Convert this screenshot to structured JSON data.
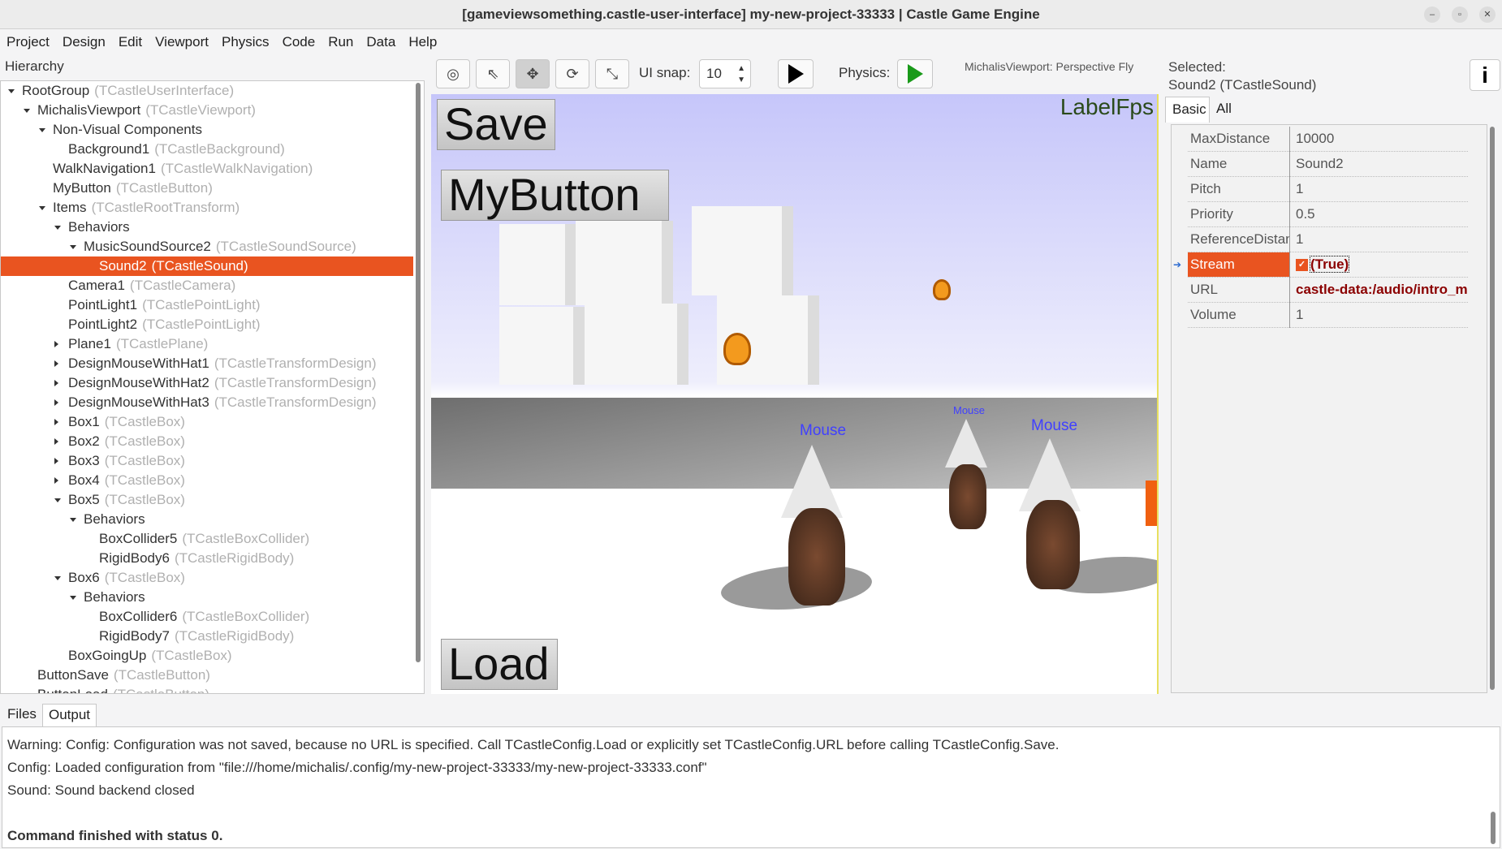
{
  "window": {
    "title": "[gameviewsomething.castle-user-interface] my-new-project-33333 | Castle Game Engine",
    "controls": [
      "–",
      "▫",
      "✕"
    ]
  },
  "menu": [
    "Project",
    "Design",
    "Edit",
    "Viewport",
    "Physics",
    "Code",
    "Run",
    "Data",
    "Help"
  ],
  "hierarchy": {
    "label": "Hierarchy",
    "items": [
      {
        "name": "RootGroup",
        "type": "(TCastleUserInterface)",
        "depth": 0,
        "exp": "open"
      },
      {
        "name": "MichalisViewport",
        "type": "(TCastleViewport)",
        "depth": 1,
        "exp": "open"
      },
      {
        "name": "Non-Visual Components",
        "type": "",
        "depth": 2,
        "exp": "open"
      },
      {
        "name": "Background1",
        "type": "(TCastleBackground)",
        "depth": 3,
        "exp": ""
      },
      {
        "name": "WalkNavigation1",
        "type": "(TCastleWalkNavigation)",
        "depth": 2,
        "exp": ""
      },
      {
        "name": "MyButton",
        "type": "(TCastleButton)",
        "depth": 2,
        "exp": ""
      },
      {
        "name": "Items",
        "type": "(TCastleRootTransform)",
        "depth": 2,
        "exp": "open"
      },
      {
        "name": "Behaviors",
        "type": "",
        "depth": 3,
        "exp": "open"
      },
      {
        "name": "MusicSoundSource2",
        "type": "(TCastleSoundSource)",
        "depth": 4,
        "exp": "open"
      },
      {
        "name": "Sound2",
        "type": "(TCastleSound)",
        "depth": 5,
        "exp": "",
        "selected": true
      },
      {
        "name": "Camera1",
        "type": "(TCastleCamera)",
        "depth": 3,
        "exp": ""
      },
      {
        "name": "PointLight1",
        "type": "(TCastlePointLight)",
        "depth": 3,
        "exp": ""
      },
      {
        "name": "PointLight2",
        "type": "(TCastlePointLight)",
        "depth": 3,
        "exp": ""
      },
      {
        "name": "Plane1",
        "type": "(TCastlePlane)",
        "depth": 3,
        "exp": "closed"
      },
      {
        "name": "DesignMouseWithHat1",
        "type": "(TCastleTransformDesign)",
        "depth": 3,
        "exp": "closed"
      },
      {
        "name": "DesignMouseWithHat2",
        "type": "(TCastleTransformDesign)",
        "depth": 3,
        "exp": "closed"
      },
      {
        "name": "DesignMouseWithHat3",
        "type": "(TCastleTransformDesign)",
        "depth": 3,
        "exp": "closed"
      },
      {
        "name": "Box1",
        "type": "(TCastleBox)",
        "depth": 3,
        "exp": "closed"
      },
      {
        "name": "Box2",
        "type": "(TCastleBox)",
        "depth": 3,
        "exp": "closed"
      },
      {
        "name": "Box3",
        "type": "(TCastleBox)",
        "depth": 3,
        "exp": "closed"
      },
      {
        "name": "Box4",
        "type": "(TCastleBox)",
        "depth": 3,
        "exp": "closed"
      },
      {
        "name": "Box5",
        "type": "(TCastleBox)",
        "depth": 3,
        "exp": "open"
      },
      {
        "name": "Behaviors",
        "type": "",
        "depth": 4,
        "exp": "open"
      },
      {
        "name": "BoxCollider5",
        "type": "(TCastleBoxCollider)",
        "depth": 5,
        "exp": ""
      },
      {
        "name": "RigidBody6",
        "type": "(TCastleRigidBody)",
        "depth": 5,
        "exp": ""
      },
      {
        "name": "Box6",
        "type": "(TCastleBox)",
        "depth": 3,
        "exp": "open"
      },
      {
        "name": "Behaviors",
        "type": "",
        "depth": 4,
        "exp": "open"
      },
      {
        "name": "BoxCollider6",
        "type": "(TCastleBoxCollider)",
        "depth": 5,
        "exp": ""
      },
      {
        "name": "RigidBody7",
        "type": "(TCastleRigidBody)",
        "depth": 5,
        "exp": ""
      },
      {
        "name": "BoxGoingUp",
        "type": "(TCastleBox)",
        "depth": 3,
        "exp": ""
      },
      {
        "name": "ButtonSave",
        "type": "(TCastleButton)",
        "depth": 1,
        "exp": ""
      },
      {
        "name": "ButtonLoad",
        "type": "(TCastleButton)",
        "depth": 1,
        "exp": ""
      }
    ]
  },
  "toolbar": {
    "snap_label": "UI snap:",
    "snap_value": "10",
    "physics_label": "Physics:",
    "viewport_info": "MichalisViewport: Perspective Fly",
    "tools": [
      "interact-icon",
      "select-icon",
      "translate-icon",
      "rotate-icon",
      "scale-icon"
    ],
    "play_color": "#000000",
    "physics_play_color": "#1a9a1a"
  },
  "viewport": {
    "save": "Save",
    "mybutton": "MyButton",
    "load": "Load",
    "labelfps": "LabelFps",
    "mouse_labels": [
      "Mouse",
      "Mouse",
      "Mouse"
    ]
  },
  "inspector": {
    "selected_label": "Selected:",
    "selected_value": "Sound2 (TCastleSound)",
    "info": "i",
    "tabs": [
      "Basic",
      "All"
    ],
    "active_tab": "Basic",
    "properties": [
      {
        "name": "MaxDistance",
        "value": "10000"
      },
      {
        "name": "Name",
        "value": "Sound2"
      },
      {
        "name": "Pitch",
        "value": "1"
      },
      {
        "name": "Priority",
        "value": "0.5"
      },
      {
        "name": "ReferenceDistance",
        "value": "1"
      },
      {
        "name": "Stream",
        "value": "(True)",
        "checked": true,
        "selected": true
      },
      {
        "name": "URL",
        "value": "castle-data:/audio/intro_music.ogg",
        "strong": true
      },
      {
        "name": "Volume",
        "value": "1"
      }
    ]
  },
  "bottom": {
    "tabs": [
      "Files",
      "Output"
    ],
    "active_tab": "Output",
    "lines": [
      "Warning: Config: Configuration was not saved, because no URL is specified. Call TCastleConfig.Load or explicitly set TCastleConfig.URL before calling TCastleConfig.Save.",
      "Config: Loaded configuration from \"file:///home/michalis/.config/my-new-project-33333/my-new-project-33333.conf\"",
      "Sound: Sound backend closed",
      "",
      "Command finished with status 0."
    ]
  },
  "colors": {
    "accent": "#e95420",
    "label_fps": "#2a4a1a",
    "mouse_label": "#4040ff",
    "url": "#8b0000"
  }
}
